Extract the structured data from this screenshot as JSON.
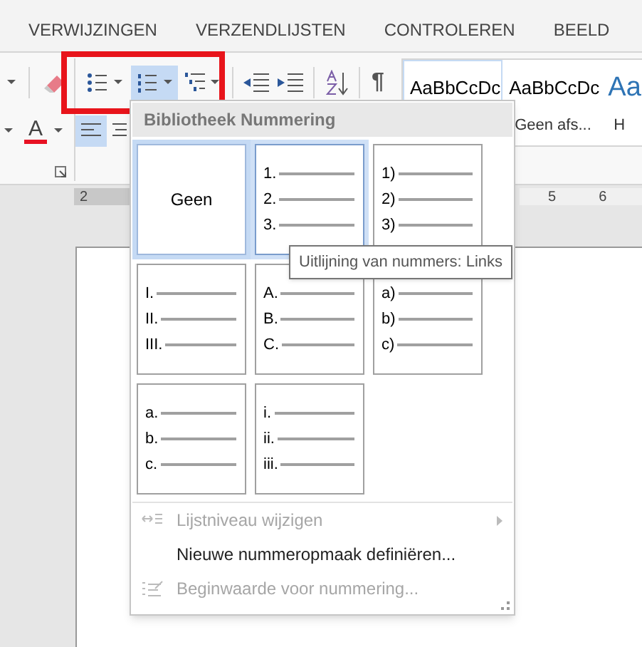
{
  "ribbon_tabs": [
    {
      "label": "VERWIJZINGEN",
      "selected": false
    },
    {
      "label": "VERZENDLIJSTEN",
      "selected": false
    },
    {
      "label": "CONTROLEREN",
      "selected": false
    },
    {
      "label": "BEELD",
      "selected": false
    }
  ],
  "paragraph_tools": {
    "bullets_selected": false,
    "numbering_selected": true,
    "align_left_selected": true,
    "font_color": {
      "glyph": "A",
      "color": "#e81123"
    },
    "pilcrow": "¶"
  },
  "styles": [
    {
      "kind": "normal",
      "preview": "AaBbCcDc",
      "selected": true
    },
    {
      "kind": "normal",
      "preview": "AaBbCcDc",
      "label": "Geen afs...",
      "selected": false
    },
    {
      "kind": "heading",
      "preview": "Aa",
      "label": "H",
      "selected": false
    }
  ],
  "ruler": {
    "left_marks": [
      "2"
    ],
    "right_marks": [
      "5",
      "6"
    ]
  },
  "numbering_menu": {
    "title": "Bibliotheek Nummering",
    "formats": [
      {
        "kind": "none",
        "label": "Geen",
        "selected": true,
        "hovered": false
      },
      {
        "kind": "list",
        "markers": [
          "1.",
          "2.",
          "3."
        ],
        "selected": false,
        "hovered": true
      },
      {
        "kind": "list",
        "markers": [
          "1)",
          "2)",
          "3)"
        ],
        "selected": false,
        "hovered": false
      },
      {
        "kind": "list",
        "markers": [
          "I.",
          "II.",
          "III."
        ],
        "selected": false,
        "hovered": false
      },
      {
        "kind": "list",
        "markers": [
          "A.",
          "B.",
          "C."
        ],
        "selected": false,
        "hovered": false
      },
      {
        "kind": "list",
        "markers": [
          "a)",
          "b)",
          "c)"
        ],
        "selected": false,
        "hovered": false
      },
      {
        "kind": "list",
        "markers": [
          "a.",
          "b.",
          "c."
        ],
        "selected": false,
        "hovered": false
      },
      {
        "kind": "list",
        "markers": [
          "i.",
          "ii.",
          "iii."
        ],
        "selected": false,
        "hovered": false
      }
    ],
    "items": [
      {
        "kind": "level",
        "label": "Lijstniveau wijzigen",
        "disabled": true,
        "submenu": true
      },
      {
        "kind": "define",
        "label": "Nieuwe nummeropmaak definiëren...",
        "disabled": false,
        "submenu": false
      },
      {
        "kind": "start",
        "label": "Beginwaarde voor nummering...",
        "disabled": true,
        "submenu": false
      }
    ]
  },
  "tooltip": {
    "text": "Uitlijning van nummers: Links"
  }
}
